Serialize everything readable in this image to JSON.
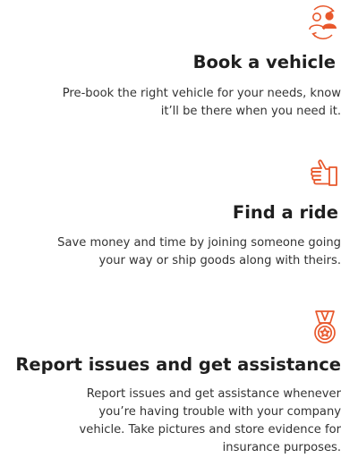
{
  "accent_color": "#e8582c",
  "features": [
    {
      "icon": "user-swap-icon",
      "title": "Book a vehicle",
      "lines": [
        "Pre-book the right vehicle for your needs, know",
        "it’ll be there when you need it."
      ]
    },
    {
      "icon": "hand-thumbs-up-icon",
      "title": "Find a ride",
      "lines": [
        "Save money and time by joining someone going",
        "your way or ship goods along with theirs."
      ]
    },
    {
      "icon": "medal-icon",
      "title": "Report issues and get assistance",
      "lines": [
        "Report issues and get assistance whenever",
        "you’re having trouble with your company",
        "vehicle. Take pictures and store evidence for",
        "insurance purposes."
      ]
    }
  ]
}
